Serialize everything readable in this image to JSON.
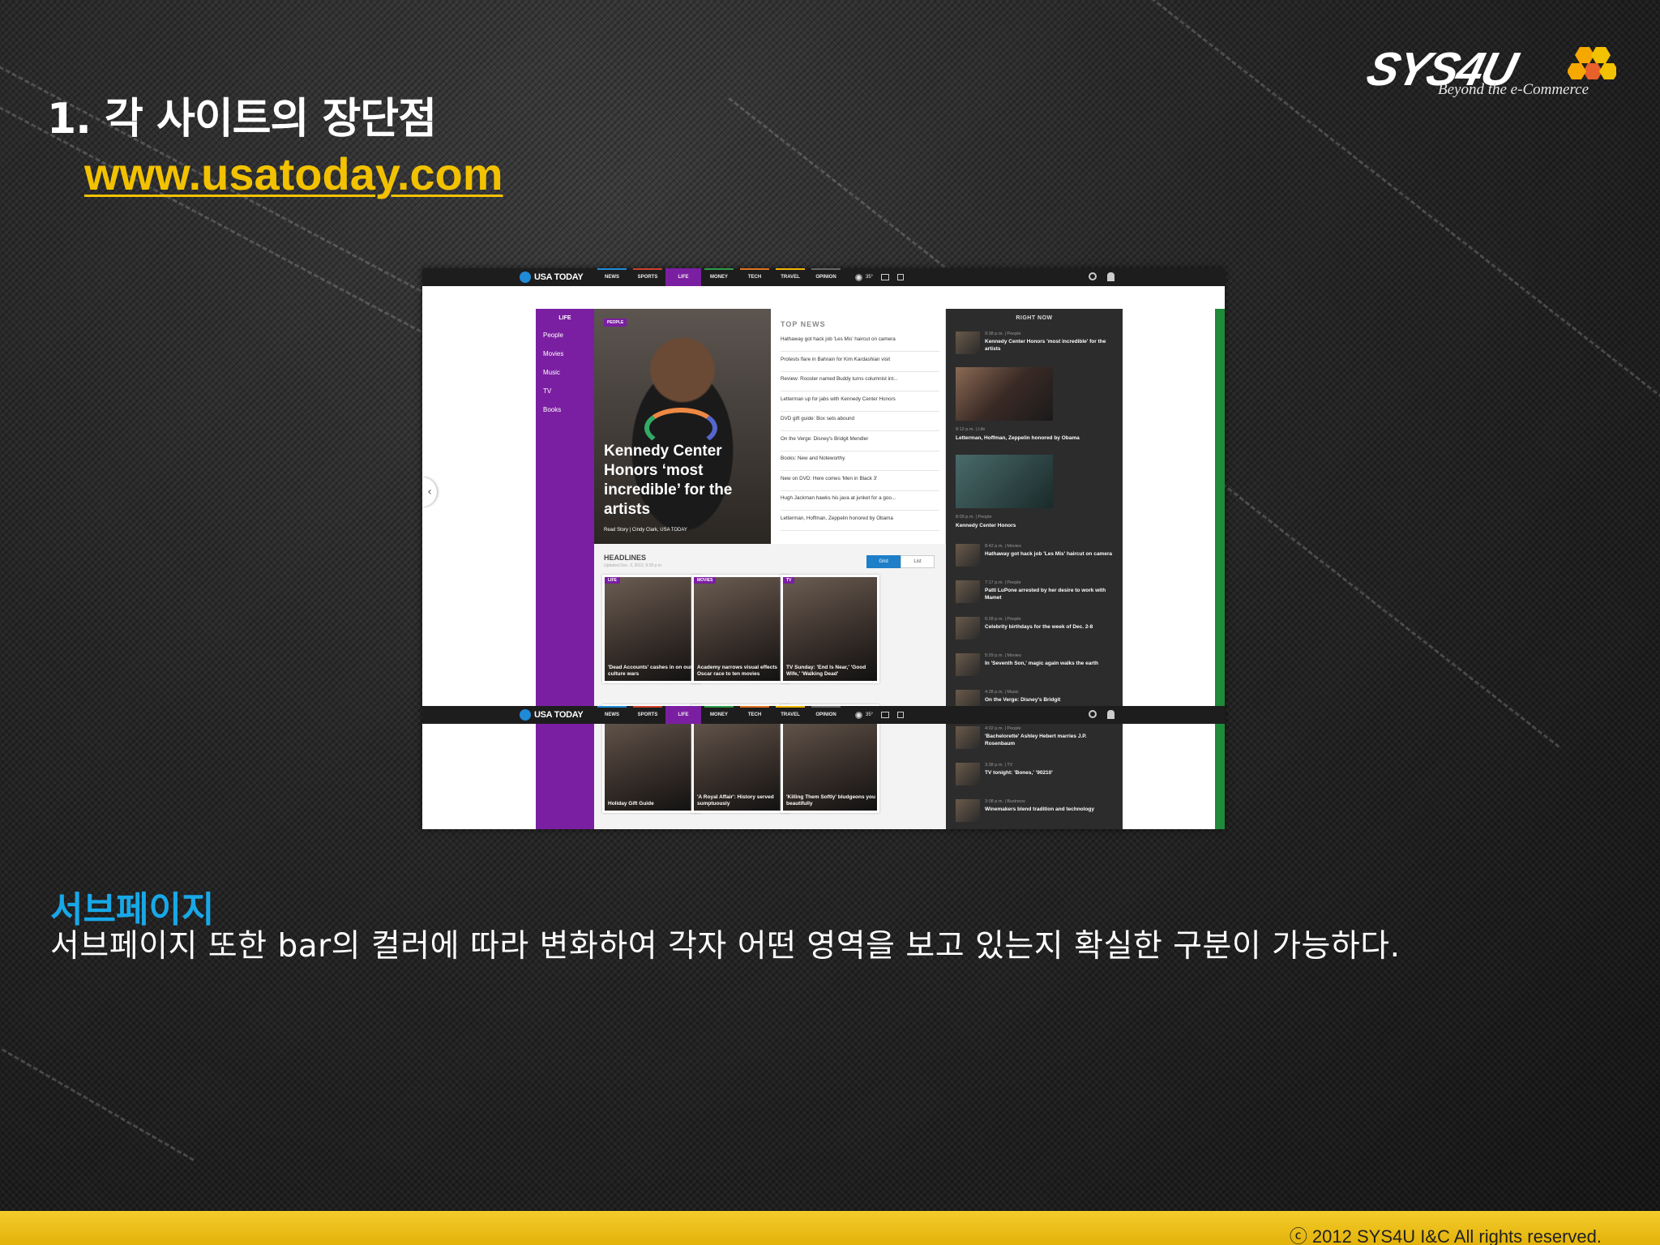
{
  "slide": {
    "title": "1. 각 사이트의 장단점",
    "site_url": "www.usatoday.com",
    "logo_text": "SYS4U",
    "logo_tagline": "Beyond the e-Commerce",
    "section_heading": "서브페이지",
    "section_body": "서브페이지 또한 bar의 컬러에 따라 변화하여 각자 어떤 영역을 보고 있는지 확실한 구분이 가능하다.",
    "copyright": "ⓒ  2012 SYS4U I&C All rights reserved.",
    "footer_color": "#f2c200",
    "accent_color": "#18a8e8"
  },
  "screenshot": {
    "brand": "USA TODAY",
    "nav": [
      {
        "label": "NEWS",
        "color": "#1f8ad7"
      },
      {
        "label": "SPORTS",
        "color": "#d0402a"
      },
      {
        "label": "LIFE",
        "color": "#7b1fa2"
      },
      {
        "label": "MONEY",
        "color": "#2a9d4a"
      },
      {
        "label": "TECH",
        "color": "#e0731e"
      },
      {
        "label": "TRAVEL",
        "color": "#f2b400"
      },
      {
        "label": "OPINION",
        "color": "#666666"
      }
    ],
    "weather": "35°",
    "sidebar": {
      "heading": "LIFE",
      "items": [
        "People",
        "Movies",
        "Music",
        "TV",
        "Books"
      ]
    },
    "hero": {
      "tag": "PEOPLE",
      "title": "Kennedy Center Honors ‘most incredible’ for the artists",
      "credit": "Read Story  |  Cindy Clark, USA TODAY"
    },
    "top_news": {
      "heading": "TOP NEWS",
      "items": [
        "Hathaway got hack job 'Les Mis' haircut on camera",
        "Protests flare in Bahrain for Kim Kardashian visit",
        "Review: Rooster named Buddy turns columnist int...",
        "Letterman up for jabs with Kennedy Center Honors",
        "DVD gift guide: Box sets abound",
        "On the Verge: Disney's Bridgit Mendler",
        "Books: New and Noteworthy",
        "New on DVD: Here comes 'Men in Black 3'",
        "Hugh Jackman hawks his java at junket for a goo...",
        "Letterman, Hoffman, Zeppelin honored by Obama"
      ]
    },
    "right_now": {
      "heading": "RIGHT NOW",
      "first": {
        "time": "9:38 p.m.  |  People",
        "text": "Kennedy Center Honors 'most incredible' for the artists"
      },
      "big1": {
        "caption": "Letterman, Hoffman, Zeppelin honored by Obama",
        "time": "9:12 p.m.  |  Life"
      },
      "big2": {
        "caption": "Kennedy Center Honors",
        "time": "8:09 p.m.  |  People"
      },
      "items": [
        {
          "time": "8:42 p.m.  |  Movies",
          "text": "Hathaway got hack job 'Les Mis' haircut on camera"
        },
        {
          "time": "7:17 p.m.  |  People",
          "text": "Patti LuPone arrested by her desire to work with Mamet"
        },
        {
          "time": "6:28 p.m.  |  People",
          "text": "Celebrity birthdays for the week of Dec. 2-8"
        },
        {
          "time": "5:29 p.m.  |  Movies",
          "text": "In 'Seventh Son,' magic again walks the earth"
        },
        {
          "time": "4:28 p.m.  |  Music",
          "text": "On the Verge: Disney's Bridgit"
        },
        {
          "time": "4:02 p.m.  |  People",
          "text": "'Bachelorette' Ashley Hebert marries J.P. Rosenbaum"
        },
        {
          "time": "3:38 p.m.  |  TV",
          "text": "TV tonight: 'Bones,' '90210'"
        },
        {
          "time": "3:08 p.m.  |  Business",
          "text": "Winemakers blend tradition and technology"
        }
      ]
    },
    "headlines": {
      "title": "HEADLINES",
      "updated": "Updated Dec. 3, 2012, 9:29 p.m.",
      "grid_label": "Grid",
      "list_label": "List",
      "cards": [
        {
          "tag": "LIFE",
          "caption": "'Dead Accounts' cashes in on our culture wars"
        },
        {
          "tag": "MOVIES",
          "caption": "Academy narrows visual effects Oscar race to ten movies"
        },
        {
          "tag": "TV",
          "caption": "TV Sunday: 'End Is Near,' 'Good Wife,' 'Walking Dead'"
        },
        {
          "tag": "",
          "caption": "Holiday Gift Guide"
        },
        {
          "tag": "",
          "caption": "'A Royal Affair': History served sumptuously"
        },
        {
          "tag": "",
          "caption": "'Killing Them Softly' bludgeons you beautifully"
        }
      ]
    }
  }
}
